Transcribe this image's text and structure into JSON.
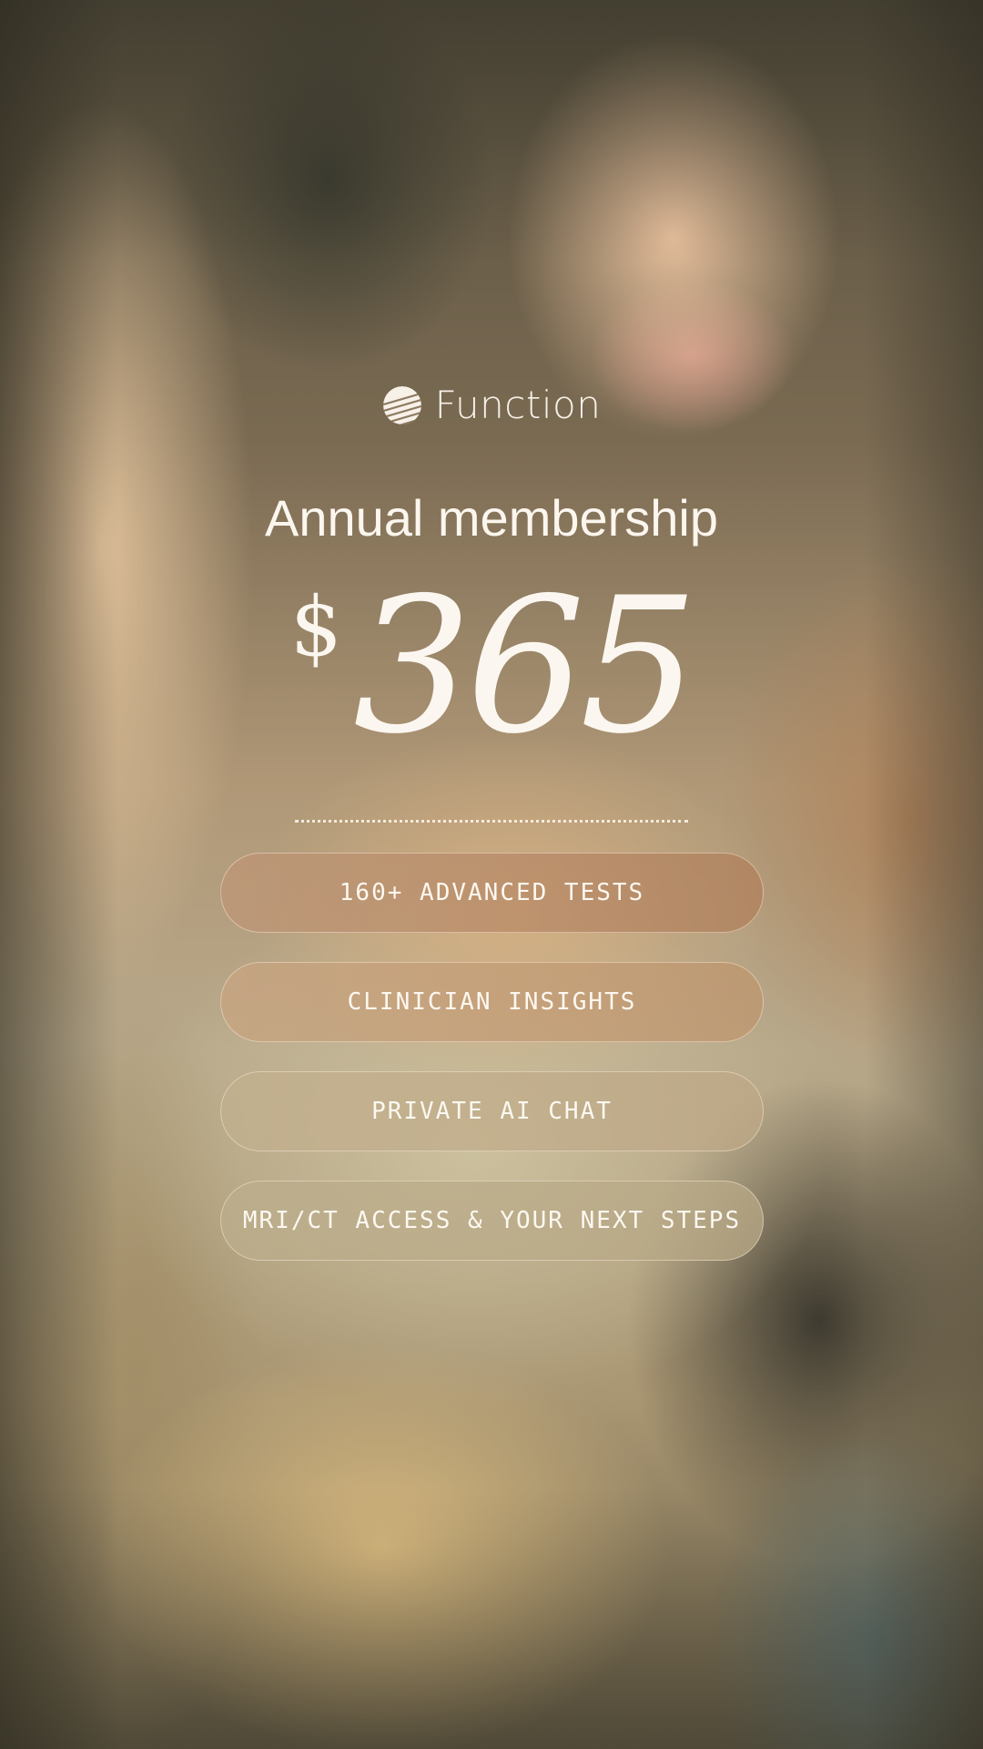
{
  "brand": {
    "name": "Function"
  },
  "headline": "Annual membership",
  "price": {
    "currency": "$",
    "amount": "365"
  },
  "features": [
    "160+ ADVANCED TESTS",
    "CLINICIAN INSIGHTS",
    "PRIVATE AI CHAT",
    "MRI/CT ACCESS & YOUR NEXT STEPS"
  ],
  "colors": {
    "text": "#fbf6ee",
    "pill_border": "#f0e2d2"
  },
  "icons": {
    "logo": "striped-circle-icon"
  }
}
